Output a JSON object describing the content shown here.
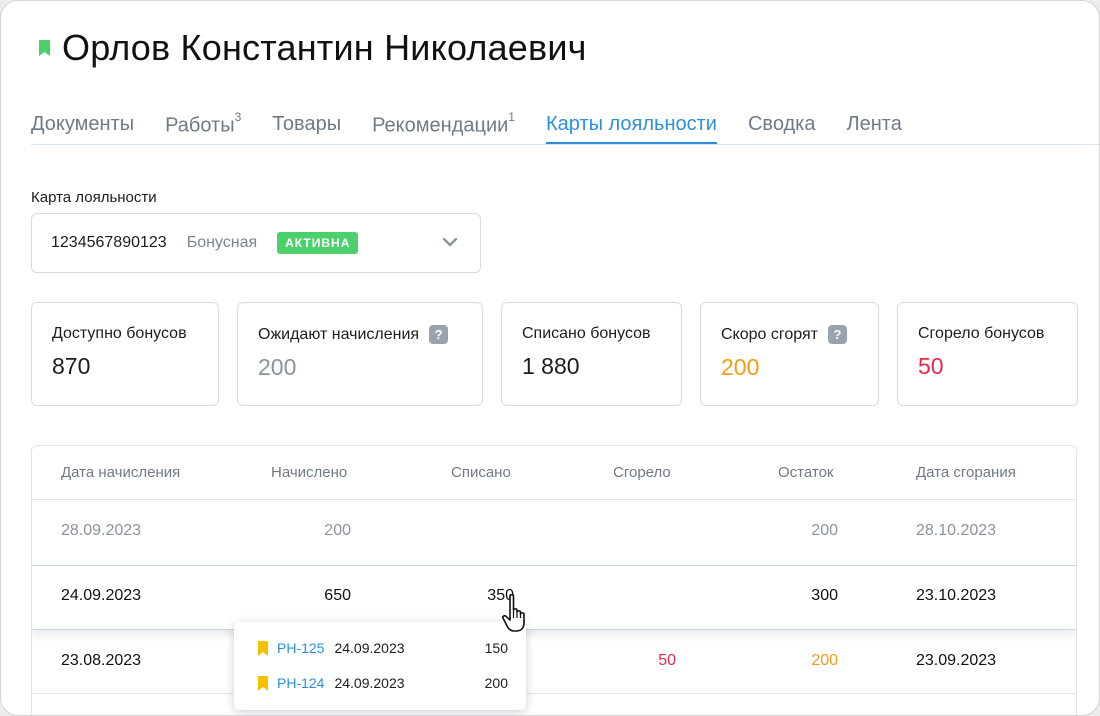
{
  "header": {
    "title": "Орлов Константин Николаевич",
    "bookmark_color": "#4cd06b"
  },
  "tabs": [
    {
      "label": "Документы",
      "sup": ""
    },
    {
      "label": "Работы",
      "sup": "3"
    },
    {
      "label": "Товары",
      "sup": ""
    },
    {
      "label": "Рекомендации",
      "sup": "1"
    },
    {
      "label": "Карты лояльности",
      "sup": "",
      "active": true
    },
    {
      "label": "Сводка",
      "sup": ""
    },
    {
      "label": "Лента",
      "sup": ""
    }
  ],
  "loyalty_card": {
    "label": "Карта лояльности",
    "number": "1234567890123",
    "type": "Бонусная",
    "status": "АКТИВНА"
  },
  "stats": [
    {
      "label": "Доступно бонусов",
      "value": "870",
      "help": false
    },
    {
      "label": "Ожидают начисления",
      "value": "200",
      "help": true
    },
    {
      "label": "Списано бонусов",
      "value": "1 880",
      "help": false
    },
    {
      "label": "Скоро сгорят",
      "value": "200",
      "help": true
    },
    {
      "label": "Сгорело бонусов",
      "value": "50",
      "help": false
    }
  ],
  "help_glyph": "?",
  "table": {
    "headers": [
      "Дата начисления",
      "Начислено",
      "Списано",
      "Сгорело",
      "Остаток",
      "Дата сгорания"
    ],
    "rows": [
      {
        "date": "28.09.2023",
        "accrued": "200",
        "spent": "",
        "burned": "",
        "balance": "200",
        "expiry": "28.10.2023"
      },
      {
        "date": "24.09.2023",
        "accrued": "650",
        "spent": "350",
        "burned": "",
        "balance": "300",
        "expiry": "23.10.2023"
      },
      {
        "date": "23.08.2023",
        "accrued": "",
        "spent": "",
        "burned": "50",
        "balance": "200",
        "expiry": "23.09.2023"
      }
    ]
  },
  "popup": {
    "items": [
      {
        "doc": "РН-125",
        "date": "24.09.2023",
        "amount": "150"
      },
      {
        "doc": "РН-124",
        "date": "24.09.2023",
        "amount": "200"
      }
    ]
  },
  "colors": {
    "accent": "#2b8fe0",
    "active_badge": "#4cd06b",
    "warning": "#f39c12",
    "danger": "#e8284d"
  }
}
